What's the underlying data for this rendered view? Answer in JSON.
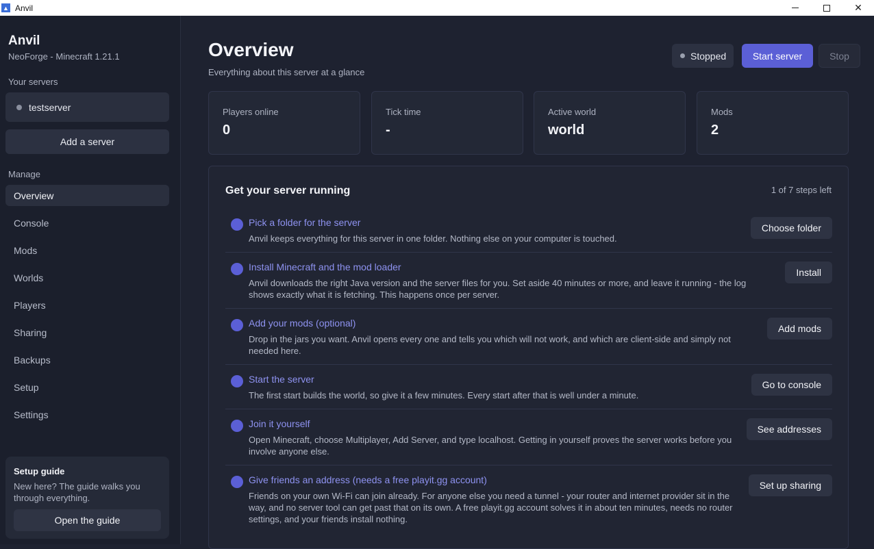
{
  "window": {
    "title": "Anvil"
  },
  "sidebar": {
    "app_name": "Anvil",
    "subtitle": "NeoForge - Minecraft 1.21.1",
    "servers_label": "Your servers",
    "servers": [
      {
        "name": "testserver",
        "status_color": "#8a8f9e"
      }
    ],
    "add_server_label": "Add a server",
    "manage_label": "Manage",
    "nav": [
      {
        "label": "Overview",
        "active": true
      },
      {
        "label": "Console"
      },
      {
        "label": "Mods"
      },
      {
        "label": "Worlds"
      },
      {
        "label": "Players"
      },
      {
        "label": "Sharing"
      },
      {
        "label": "Backups"
      },
      {
        "label": "Setup"
      },
      {
        "label": "Settings"
      }
    ],
    "guide": {
      "title": "Setup guide",
      "description": "New here? The guide walks you through everything.",
      "button": "Open the guide"
    }
  },
  "header": {
    "title": "Overview",
    "subtitle": "Everything about this server at a glance",
    "status": "Stopped",
    "start_label": "Start server",
    "stop_label": "Stop"
  },
  "stats": [
    {
      "label": "Players online",
      "value": "0"
    },
    {
      "label": "Tick time",
      "value": "-"
    },
    {
      "label": "Active world",
      "value": "world"
    },
    {
      "label": "Mods",
      "value": "2"
    }
  ],
  "steps": {
    "title": "Get your server running",
    "remaining": "1 of 7 steps left",
    "items": [
      {
        "title": "Pick a folder for the server",
        "description": "Anvil keeps everything for this server in one folder. Nothing else on your computer is touched.",
        "button": "Choose folder"
      },
      {
        "title": "Install Minecraft and the mod loader",
        "description": "Anvil downloads the right Java version and the server files for you. Set aside 40 minutes or more, and leave it running - the log shows exactly what it is fetching. This happens once per server.",
        "button": "Install"
      },
      {
        "title": "Add your mods (optional)",
        "description": "Drop in the jars you want. Anvil opens every one and tells you which will not work, and which are client-side and simply not needed here.",
        "button": "Add mods"
      },
      {
        "title": "Start the server",
        "description": "The first start builds the world, so give it a few minutes. Every start after that is well under a minute.",
        "button": "Go to console"
      },
      {
        "title": "Join it yourself",
        "description": "Open Minecraft, choose Multiplayer, Add Server, and type localhost. Getting in yourself proves the server works before you involve anyone else.",
        "button": "See addresses"
      },
      {
        "title": "Give friends an address (needs a free playit.gg account)",
        "description": "Friends on your own Wi-Fi can join already. For anyone else you need a tunnel - your router and internet provider sit in the way, and no server tool can get past that on its own. A free playit.gg account solves it in about ten minutes, needs no router settings, and your friends install nothing.",
        "button": "Set up sharing"
      }
    ]
  }
}
